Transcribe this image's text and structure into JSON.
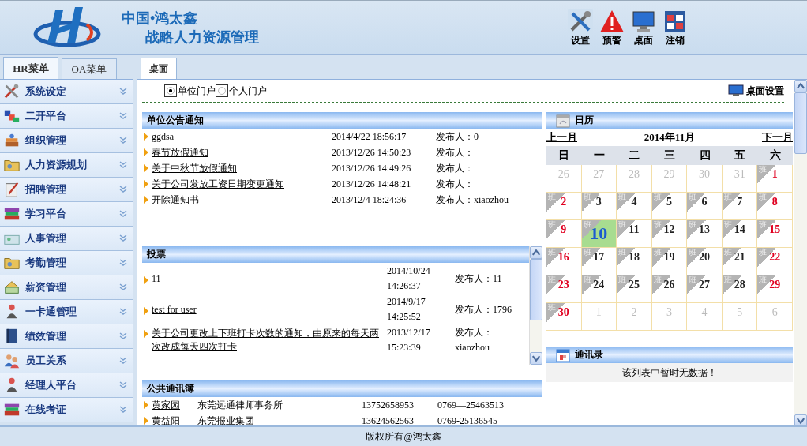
{
  "header": {
    "brand": "中国•鸿太鑫",
    "subtitle": "战略人力资源管理",
    "actions": [
      {
        "label": "设置",
        "kind": "settings"
      },
      {
        "label": "预警",
        "kind": "warning"
      },
      {
        "label": "桌面",
        "kind": "desktop"
      },
      {
        "label": "注销",
        "kind": "logout"
      }
    ]
  },
  "sidebar": {
    "tabs": [
      {
        "label": "HR菜单",
        "selected": true
      },
      {
        "label": "OA菜单",
        "selected": false
      }
    ],
    "items": [
      {
        "label": "系统设定",
        "kind": "tools"
      },
      {
        "label": "二开平台",
        "kind": "blocks"
      },
      {
        "label": "组织管理",
        "kind": "stack"
      },
      {
        "label": "人力资源规划",
        "kind": "folder"
      },
      {
        "label": "招聘管理",
        "kind": "clipboard"
      },
      {
        "label": "学习平台",
        "kind": "books"
      },
      {
        "label": "人事管理",
        "kind": "card"
      },
      {
        "label": "考勤管理",
        "kind": "folder"
      },
      {
        "label": "薪资管理",
        "kind": "cash"
      },
      {
        "label": "一卡通管理",
        "kind": "person"
      },
      {
        "label": "绩效管理",
        "kind": "book"
      },
      {
        "label": "员工关系",
        "kind": "people"
      },
      {
        "label": "经理人平台",
        "kind": "person"
      },
      {
        "label": "在线考证",
        "kind": "books"
      }
    ]
  },
  "main_tabs": [
    {
      "label": "桌面",
      "selected": true
    }
  ],
  "portal": {
    "options": [
      {
        "label": "单位门户",
        "selected": true
      },
      {
        "label": "个人门户",
        "selected": false
      }
    ],
    "settings_label": "桌面设置"
  },
  "notices": {
    "title": "单位公告通知",
    "rows": [
      {
        "title": "ggdsa",
        "time": "2014/4/22 18:56:17",
        "publisher": "发布人：0"
      },
      {
        "title": "春节放假通知",
        "time": "2013/12/26 14:50:23",
        "publisher": "发布人："
      },
      {
        "title": "关于中秋节放假通知",
        "time": "2013/12/26 14:49:26",
        "publisher": "发布人："
      },
      {
        "title": "关于公司发放工资日期变更通知",
        "time": "2013/12/26 14:48:21",
        "publisher": "发布人："
      },
      {
        "title": "开除通知书",
        "time": "2013/12/4 18:24:36",
        "publisher": "发布人：xiaozhou"
      }
    ]
  },
  "votes": {
    "title": "投票",
    "rows": [
      {
        "title": "11",
        "date": "2014/10/24",
        "time": "14:26:37",
        "publisher": "发布人：11"
      },
      {
        "title": "test for user",
        "date": "2014/9/17",
        "time": "14:25:52",
        "publisher": "发布人：1796"
      },
      {
        "title": "关于公司更改上下班打卡次数的通知，由原来的每天两次改成每天四次打卡",
        "date": "2013/12/17",
        "time": "15:23:39",
        "publisher": "发布人：xiaozhou"
      }
    ]
  },
  "public_contacts": {
    "title": "公共通讯簿",
    "rows": [
      {
        "name": "黄家园",
        "company": "东莞远通律师事务所",
        "mobile": "13752658953",
        "phone": "0769—25463513"
      },
      {
        "name": "黄益阳",
        "company": "东莞报业集团",
        "mobile": "13624562563",
        "phone": "0769-25136545"
      }
    ]
  },
  "calendar": {
    "title": "日历",
    "prev": "上一月",
    "month": "2014年11月",
    "next": "下一月",
    "weekdays": [
      "日",
      "一",
      "二",
      "三",
      "四",
      "五",
      "六"
    ],
    "days": [
      {
        "day": "26",
        "kind": "other",
        "selected": false
      },
      {
        "day": "27",
        "kind": "other",
        "selected": false
      },
      {
        "day": "28",
        "kind": "other",
        "selected": false
      },
      {
        "day": "29",
        "kind": "other",
        "selected": false
      },
      {
        "day": "30",
        "kind": "other",
        "selected": false
      },
      {
        "day": "31",
        "kind": "other",
        "selected": false
      },
      {
        "day": "1",
        "kind": "current",
        "badge": "班",
        "selected": false
      },
      {
        "day": "2",
        "kind": "current",
        "badge": "班",
        "selected": false
      },
      {
        "day": "3",
        "kind": "current",
        "badge": "班",
        "selected": false
      },
      {
        "day": "4",
        "kind": "current",
        "badge": "班",
        "selected": false
      },
      {
        "day": "5",
        "kind": "current",
        "badge": "班",
        "selected": false
      },
      {
        "day": "6",
        "kind": "current",
        "badge": "班",
        "selected": false
      },
      {
        "day": "7",
        "kind": "current",
        "badge": "班",
        "selected": false
      },
      {
        "day": "8",
        "kind": "current",
        "badge": "班",
        "selected": false
      },
      {
        "day": "9",
        "kind": "current",
        "badge": "班",
        "selected": false
      },
      {
        "day": "10",
        "kind": "current",
        "badge": "班",
        "selected": true
      },
      {
        "day": "11",
        "kind": "current",
        "badge": "班",
        "selected": false
      },
      {
        "day": "12",
        "kind": "current",
        "badge": "班",
        "selected": false
      },
      {
        "day": "13",
        "kind": "current",
        "badge": "班",
        "selected": false
      },
      {
        "day": "14",
        "kind": "current",
        "badge": "班",
        "selected": false
      },
      {
        "day": "15",
        "kind": "current",
        "badge": "班",
        "selected": false
      },
      {
        "day": "16",
        "kind": "current",
        "badge": "班",
        "selected": false
      },
      {
        "day": "17",
        "kind": "current",
        "badge": "班",
        "selected": false
      },
      {
        "day": "18",
        "kind": "current",
        "badge": "班",
        "selected": false
      },
      {
        "day": "19",
        "kind": "current",
        "badge": "班",
        "selected": false
      },
      {
        "day": "20",
        "kind": "current",
        "badge": "班",
        "selected": false
      },
      {
        "day": "21",
        "kind": "current",
        "badge": "班",
        "selected": false
      },
      {
        "day": "22",
        "kind": "current",
        "badge": "班",
        "selected": false
      },
      {
        "day": "23",
        "kind": "current",
        "badge": "班",
        "selected": false
      },
      {
        "day": "24",
        "kind": "current",
        "badge": "班",
        "selected": false
      },
      {
        "day": "25",
        "kind": "current",
        "badge": "班",
        "selected": false
      },
      {
        "day": "26",
        "kind": "current",
        "badge": "班",
        "selected": false
      },
      {
        "day": "27",
        "kind": "current",
        "badge": "班",
        "selected": false
      },
      {
        "day": "28",
        "kind": "current",
        "badge": "班",
        "selected": false
      },
      {
        "day": "29",
        "kind": "current",
        "badge": "班",
        "selected": false
      },
      {
        "day": "30",
        "kind": "current",
        "badge": "班",
        "selected": false
      },
      {
        "day": "1",
        "kind": "other",
        "selected": false
      },
      {
        "day": "2",
        "kind": "other",
        "selected": false
      },
      {
        "day": "3",
        "kind": "other",
        "selected": false
      },
      {
        "day": "4",
        "kind": "other",
        "selected": false
      },
      {
        "day": "5",
        "kind": "other",
        "selected": false
      },
      {
        "day": "6",
        "kind": "other",
        "selected": false
      }
    ]
  },
  "contacts": {
    "title": "通讯录",
    "empty_message": "该列表中暂时无数据！"
  },
  "footer": "版权所有@鸿太鑫"
}
